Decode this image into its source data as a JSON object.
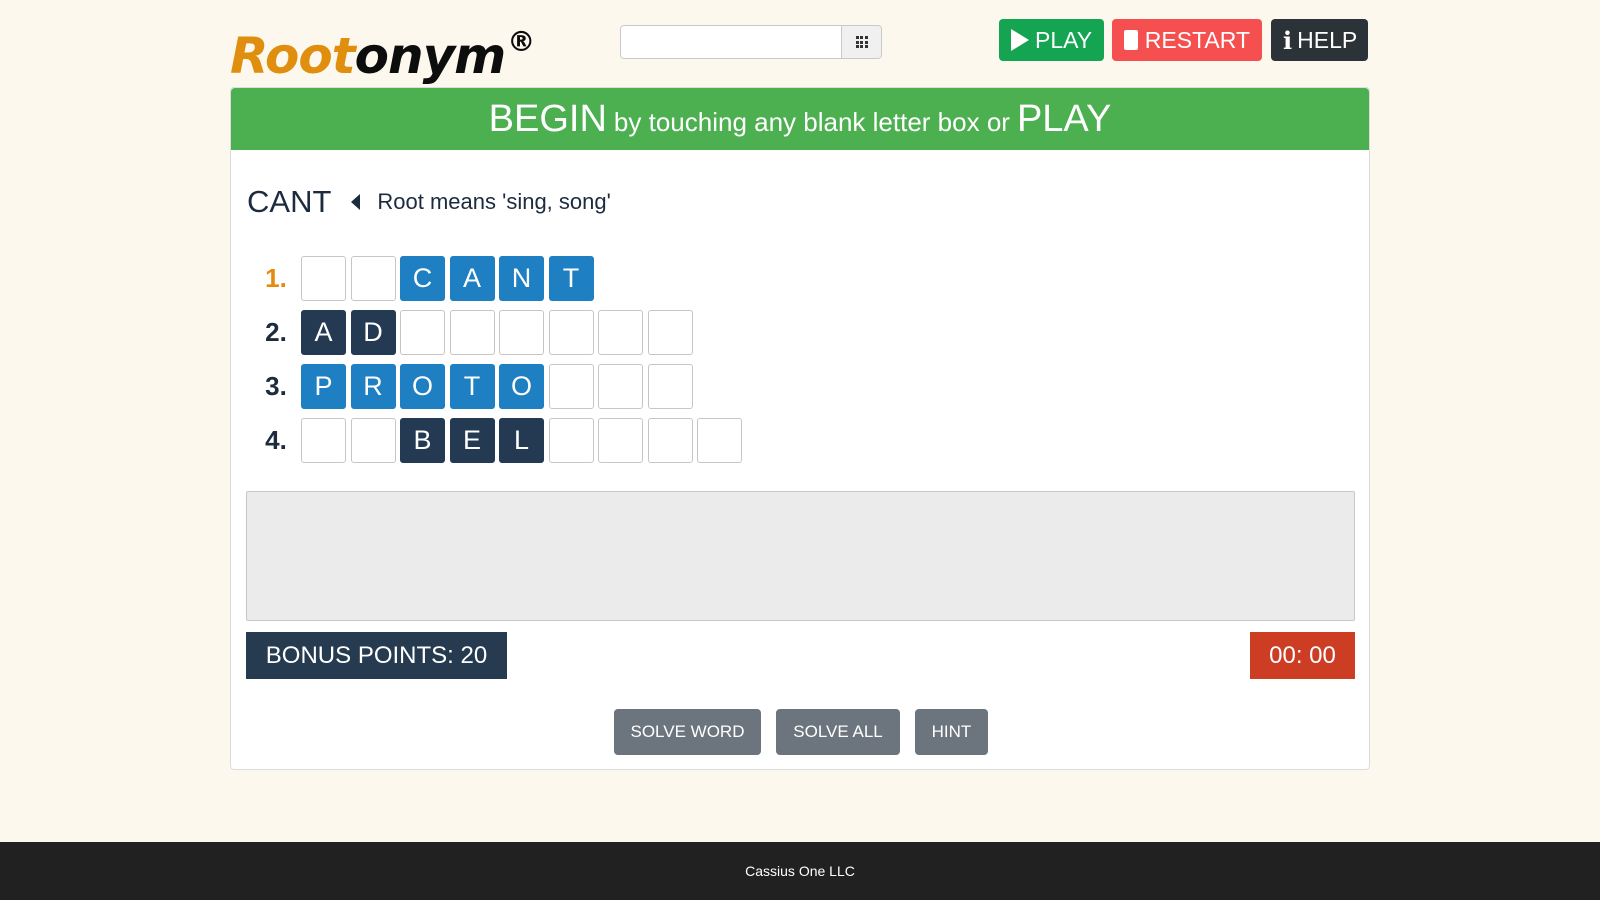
{
  "header": {
    "logo_root": "Root",
    "logo_onym": "onym",
    "logo_reg": "®",
    "search": {
      "value": "",
      "placeholder": ""
    },
    "keypad_icon": "grid-icon",
    "buttons": {
      "play": "PLAY",
      "restart": "RESTART",
      "help": "HELP"
    }
  },
  "banner": {
    "begin": "BEGIN",
    "instruction": "by touching any blank letter box or",
    "play": "PLAY",
    "color": "#4caf50"
  },
  "root": {
    "word": "CANT",
    "meaning": "Root means 'sing, song'"
  },
  "words": [
    {
      "num": "1.",
      "active": true,
      "boxes": [
        [
          "",
          ""
        ],
        [
          "",
          ""
        ],
        [
          "C",
          "root"
        ],
        [
          "A",
          "root"
        ],
        [
          "N",
          "root"
        ],
        [
          "T",
          "root"
        ]
      ]
    },
    {
      "num": "2.",
      "active": false,
      "boxes": [
        [
          "A",
          "given"
        ],
        [
          "D",
          "given"
        ],
        [
          "",
          ""
        ],
        [
          "",
          ""
        ],
        [
          "",
          ""
        ],
        [
          "",
          ""
        ],
        [
          "",
          ""
        ],
        [
          "",
          ""
        ]
      ]
    },
    {
      "num": "3.",
      "active": false,
      "boxes": [
        [
          "P",
          "root"
        ],
        [
          "R",
          "root"
        ],
        [
          "O",
          "root"
        ],
        [
          "T",
          "root"
        ],
        [
          "O",
          "root"
        ],
        [
          "",
          ""
        ],
        [
          "",
          ""
        ],
        [
          "",
          ""
        ]
      ]
    },
    {
      "num": "4.",
      "active": false,
      "boxes": [
        [
          "",
          ""
        ],
        [
          "",
          ""
        ],
        [
          "B",
          "given"
        ],
        [
          "E",
          "given"
        ],
        [
          "L",
          "given"
        ],
        [
          "",
          ""
        ],
        [
          "",
          ""
        ],
        [
          "",
          ""
        ],
        [
          "",
          ""
        ]
      ]
    }
  ],
  "status": {
    "bonus": "BONUS POINTS: 20",
    "timer": "00: 00"
  },
  "actions": {
    "solve_word": "SOLVE WORD",
    "solve_all": "SOLVE ALL",
    "hint": "HINT"
  },
  "footer": {
    "text": "Cassius One LLC"
  },
  "colors": {
    "root_box": "#1e7fc3",
    "given_box": "#233a52",
    "active_number": "#e68a0c",
    "play": "#14a452",
    "restart": "#f64f4f",
    "help": "#2c3338",
    "timer": "#cd3d24"
  }
}
